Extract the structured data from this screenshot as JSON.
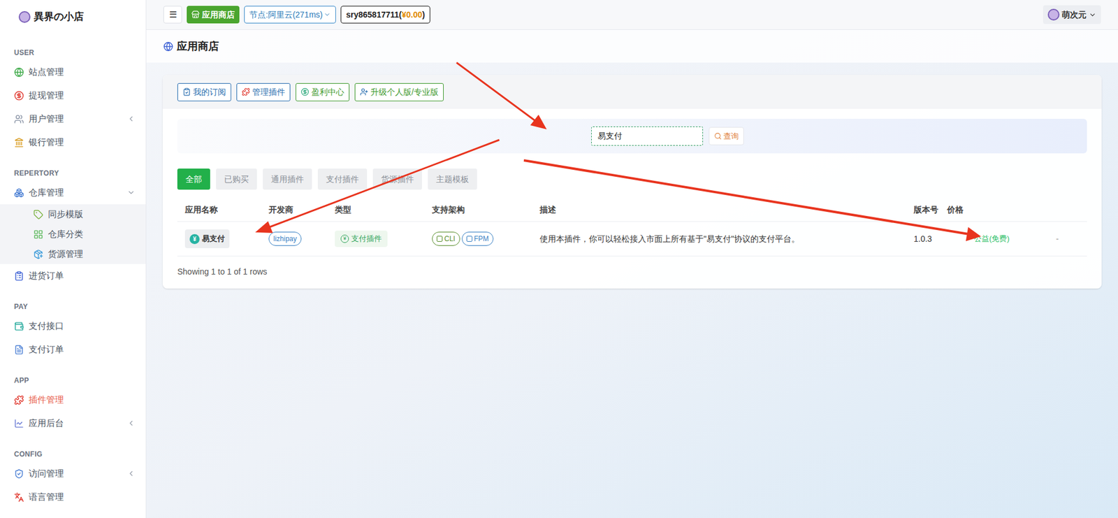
{
  "app": {
    "title": "異界の小店"
  },
  "sidebar": {
    "sections": [
      {
        "label": "USER",
        "items": [
          {
            "label": "站点管理",
            "kind": "item",
            "selected": false,
            "expandable": false,
            "expanded": false
          },
          {
            "label": "提现管理",
            "kind": "item",
            "selected": false,
            "expandable": false,
            "expanded": false
          },
          {
            "label": "用户管理",
            "kind": "item",
            "selected": false,
            "expandable": true,
            "expanded": false
          },
          {
            "label": "银行管理",
            "kind": "item",
            "selected": false,
            "expandable": false,
            "expanded": false
          }
        ]
      },
      {
        "label": "REPERTORY",
        "items": [
          {
            "label": "仓库管理",
            "kind": "item",
            "selected": false,
            "expandable": true,
            "expanded": true
          },
          {
            "label": "同步模版",
            "kind": "sub",
            "selected": false,
            "expandable": false,
            "expanded": false
          },
          {
            "label": "仓库分类",
            "kind": "sub",
            "selected": false,
            "expandable": false,
            "expanded": false
          },
          {
            "label": "货源管理",
            "kind": "sub",
            "selected": false,
            "expandable": false,
            "expanded": false
          },
          {
            "label": "进货订单",
            "kind": "item",
            "selected": false,
            "expandable": false,
            "expanded": false
          }
        ]
      },
      {
        "label": "PAY",
        "items": [
          {
            "label": "支付接口",
            "kind": "item",
            "selected": false,
            "expandable": false,
            "expanded": false
          },
          {
            "label": "支付订单",
            "kind": "item",
            "selected": false,
            "expandable": false,
            "expanded": false
          }
        ]
      },
      {
        "label": "APP",
        "items": [
          {
            "label": "插件管理",
            "kind": "item",
            "selected": true,
            "expandable": false,
            "expanded": false
          },
          {
            "label": "应用后台",
            "kind": "item",
            "selected": false,
            "expandable": true,
            "expanded": false
          }
        ]
      },
      {
        "label": "CONFIG",
        "items": [
          {
            "label": "访问管理",
            "kind": "item",
            "selected": false,
            "expandable": true,
            "expanded": false
          },
          {
            "label": "语言管理",
            "kind": "item",
            "selected": false,
            "expandable": false,
            "expanded": false
          }
        ]
      }
    ]
  },
  "topbar": {
    "menu": "☰",
    "store": "应用商店",
    "node": "节点:阿里云(271ms)",
    "account": "sry865817711(",
    "balance": "¥0.00",
    "account_end": ")",
    "user": "萌次元"
  },
  "page": {
    "title": "应用商店"
  },
  "actions": [
    {
      "label": "我的订阅",
      "color": "#2a6fb0"
    },
    {
      "label": "管理插件",
      "color": "#2a6fb0"
    },
    {
      "label": "盈利中心",
      "color": "#3f9a2e"
    },
    {
      "label": "升级个人版/专业版",
      "color": "#3f9a2e"
    }
  ],
  "search": {
    "value": "易支付",
    "button": "查询"
  },
  "filters": [
    {
      "label": "全部",
      "selected": true
    },
    {
      "label": "已购买",
      "selected": false
    },
    {
      "label": "通用插件",
      "selected": false
    },
    {
      "label": "支付插件",
      "selected": false
    },
    {
      "label": "货源插件",
      "selected": false
    },
    {
      "label": "主题模板",
      "selected": false
    }
  ],
  "table": {
    "columns": [
      "应用名称",
      "开发商",
      "类型",
      "支持架构",
      "描述",
      "版本号",
      "价格"
    ],
    "rows": [
      {
        "name": "易支付",
        "developer": "lizhipay",
        "type": "支付插件",
        "arch": [
          {
            "label": "CLI",
            "color": "#5a8f2e"
          },
          {
            "label": "FPM",
            "color": "#3b82c4"
          }
        ],
        "description": "使用本插件，你可以轻松接入市面上所有基于\"易支付\"协议的支付平台。",
        "version": "1.0.3",
        "price": "公益(免费)",
        "extra": "-"
      }
    ],
    "footer": "Showing 1 to 1 of 1 rows"
  }
}
